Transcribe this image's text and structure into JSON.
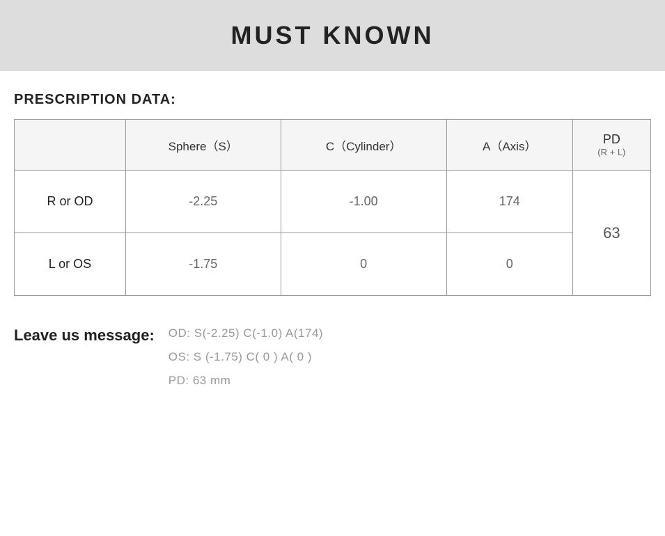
{
  "header": {
    "title": "MUST KNOWN"
  },
  "section_title": "PRESCRIPTION DATA:",
  "table": {
    "headers": {
      "empty": "",
      "sphere": "Sphere（S）",
      "cylinder": "C（Cylinder）",
      "axis": "A（Axis）",
      "pd_main": "PD",
      "pd_sub": "(R + L)"
    },
    "rows": [
      {
        "label": "R or OD",
        "sphere": "-2.25",
        "cylinder": "-1.00",
        "axis": "174",
        "pd": "63"
      },
      {
        "label": "L or OS",
        "sphere": "-1.75",
        "cylinder": "0",
        "axis": "0",
        "pd": ""
      }
    ]
  },
  "leave_message": {
    "label": "Leave us message:",
    "lines": [
      "OD:  S(-2.25)    C(-1.0)   A(174)",
      "OS:  S (-1.75)    C( 0 )     A( 0 )",
      "PD:  63 mm"
    ]
  }
}
